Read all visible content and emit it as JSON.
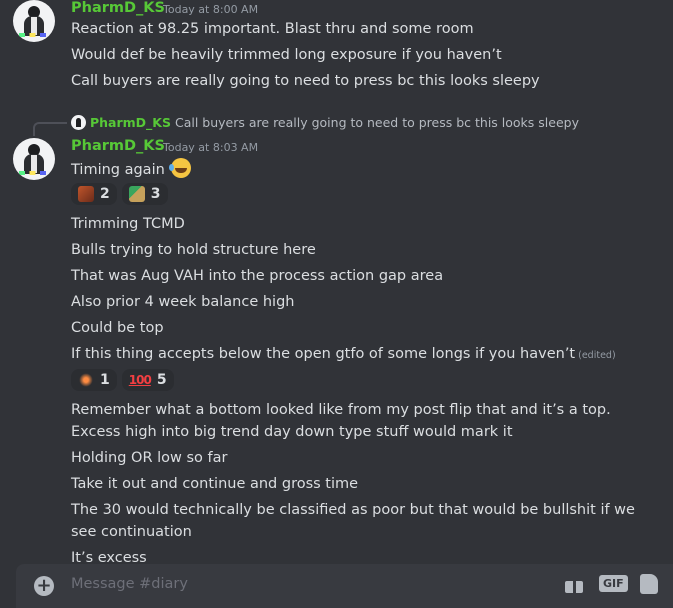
{
  "messages": [
    {
      "username": "PharmD_KS",
      "timestamp": "Today at 8:00 AM",
      "lines": [
        "Reaction at 98.25 important. Blast thru and some room",
        "Would def be heavily trimmed long exposure if you haven’t",
        "Call buyers are really going to need to press bc this looks sleepy"
      ]
    },
    {
      "reply": {
        "username": "PharmD_KS",
        "text": "Call buyers are really going to need to press bc this looks sleepy"
      },
      "username": "PharmD_KS",
      "timestamp": "Today at 8:03 AM",
      "first_line": "Timing again",
      "first_line_emoji": "rolling-on-floor-laughing-icon",
      "reactions_1": [
        {
          "emoji": "custom-emoji-icon",
          "count": "2"
        },
        {
          "emoji": "squirt-gun-icon",
          "count": "3"
        }
      ],
      "lines_a": [
        "Trimming TCMD",
        "Bulls trying to hold structure here",
        "That was Aug VAH into the process action gap area",
        "Also prior 4 week balance high",
        "Could be top"
      ],
      "edited_line": "If this thing accepts below the open gtfo of some longs if you haven’t",
      "edited_label": "(edited)",
      "reactions_2": [
        {
          "emoji": "custom-emoji-icon",
          "count": "1"
        },
        {
          "emoji": "hundred-points-icon",
          "glyph": "100",
          "count": "5"
        }
      ],
      "long_line": "Remember what a bottom looked like from my post flip that and it’s a top. Excess high into big trend day down type stuff would mark it",
      "lines_b": [
        "Holding OR low so far",
        "Take it out and continue and gross time"
      ],
      "long_line_2": "The 30 would technically be classified as poor but that would be bullshit if we see continuation",
      "last_line": "It’s excess"
    }
  ],
  "composer": {
    "placeholder": "Message #diary",
    "gif_label": "GIF"
  }
}
